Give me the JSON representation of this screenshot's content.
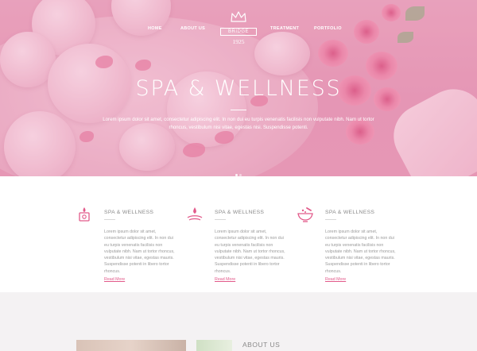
{
  "nav": {
    "left": [
      "HOME",
      "ABOUT US"
    ],
    "right": [
      "TREATMENT",
      "PORTFOLIO"
    ]
  },
  "logo": {
    "name": "BRIDGE",
    "year": "1925",
    "icon": "crown-icon"
  },
  "hero": {
    "title": "SPA & WELLNESS",
    "text_line1": "Lorem ipsum dolor sit amet, consectetur adipiscing elit. In non dui eu turpis venenatis facilisis non vulputate nibh. Nam ut tortor",
    "text_line2": "rhoncus, vestibulum nisi vitae, egestas nisi. Suspendisse potenti."
  },
  "features": [
    {
      "icon": "candle-icon",
      "title": "SPA & WELLNESS",
      "lines": [
        "Lorem ipsum dolor sit amet,",
        "consectetur adipiscing elit. In non dui",
        "eu turpis venenatis facilisis non",
        "vulputate nibh. Nam ut tortor rhoncus,",
        "vestibulum nisi vitae, egestas mauris.",
        "Suspendisse potenti in libero tortor",
        "rhoncus."
      ],
      "more": "Read More"
    },
    {
      "icon": "water-drop-icon",
      "title": "SPA & WELLNESS",
      "lines": [
        "Lorem ipsum dolor sit amet,",
        "consectetur adipiscing elit. In non dui",
        "eu turpis venenatis facilisis non",
        "vulputate nibh. Nam ut tortor rhoncus,",
        "vestibulum nisi vitae, egestas mauris.",
        "Suspendisse potenti in libero tortor",
        "rhoncus."
      ],
      "more": "Read More"
    },
    {
      "icon": "mortar-bowl-icon",
      "title": "SPA & WELLNESS",
      "lines": [
        "Lorem ipsum dolor sit amet,",
        "consectetur adipiscing elit. In non dui",
        "eu turpis venenatis facilisis non",
        "vulputate nibh. Nam ut tortor rhoncus,",
        "vestibulum nisi vitae, egestas mauris.",
        "Suspendisse potenti in libero tortor",
        "rhoncus."
      ],
      "more": "Read More"
    }
  ],
  "about": {
    "title": "ABOUT US"
  },
  "colors": {
    "accent": "#e25a8a",
    "hero": "#e69bb7",
    "text": "#9a9a9a"
  }
}
